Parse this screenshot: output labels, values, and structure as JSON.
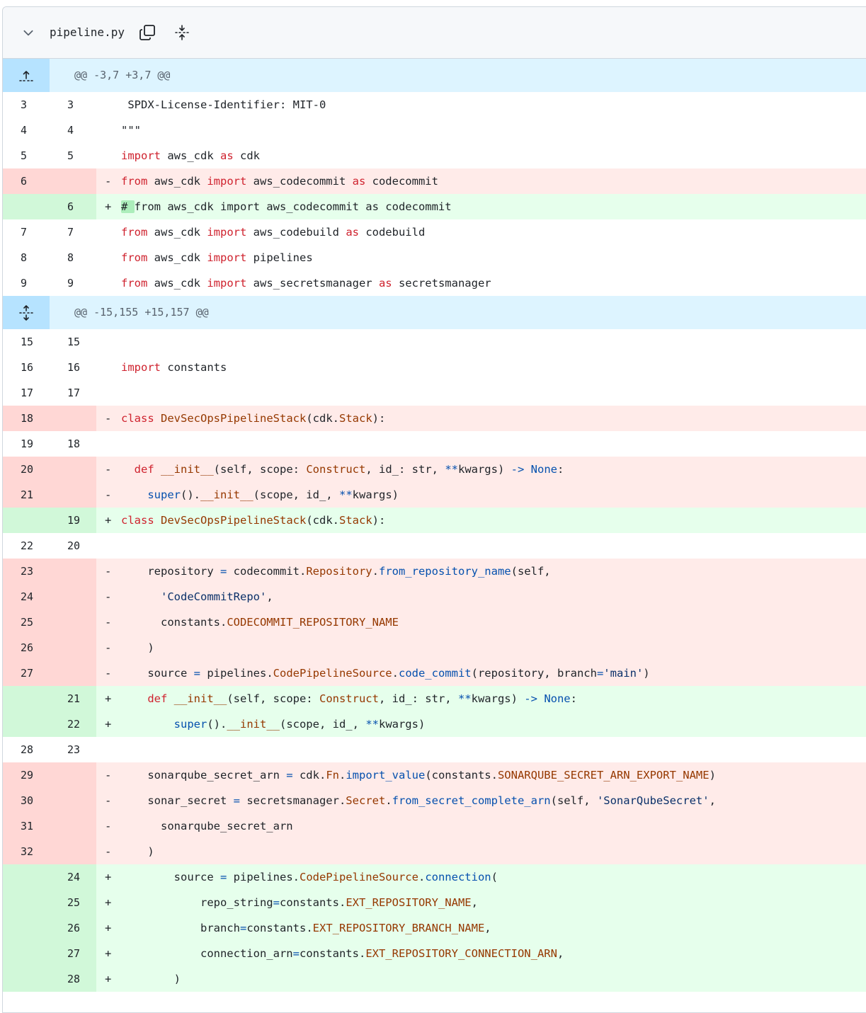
{
  "file": {
    "name": "pipeline.py"
  },
  "hunks": [
    {
      "header": "@@ -3,7 +3,7 @@"
    },
    {
      "header": "@@ -15,155 +15,157 @@"
    }
  ],
  "lines": [
    {
      "type": "ctx",
      "old": "3",
      "new": "3",
      "segs": [
        [
          "p",
          " SPDX-License-Identifier: MIT-0"
        ]
      ]
    },
    {
      "type": "ctx",
      "old": "4",
      "new": "4",
      "segs": [
        [
          "p",
          "\"\"\""
        ]
      ]
    },
    {
      "type": "ctx",
      "old": "5",
      "new": "5",
      "segs": [
        [
          "k",
          "import"
        ],
        [
          "p",
          " aws_cdk "
        ],
        [
          "k",
          "as"
        ],
        [
          "p",
          " cdk"
        ]
      ]
    },
    {
      "type": "del",
      "old": "6",
      "new": "",
      "segs": [
        [
          "k",
          "from"
        ],
        [
          "p",
          " aws_cdk "
        ],
        [
          "k",
          "import"
        ],
        [
          "p",
          " aws_codecommit "
        ],
        [
          "k",
          "as"
        ],
        [
          "p",
          " codecommit"
        ]
      ]
    },
    {
      "type": "add",
      "old": "",
      "new": "6",
      "segs": [
        [
          "hl",
          "# "
        ],
        [
          "p",
          "from aws_cdk import aws_codecommit as codecommit"
        ]
      ]
    },
    {
      "type": "ctx",
      "old": "7",
      "new": "7",
      "segs": [
        [
          "k",
          "from"
        ],
        [
          "p",
          " aws_cdk "
        ],
        [
          "k",
          "import"
        ],
        [
          "p",
          " aws_codebuild "
        ],
        [
          "k",
          "as"
        ],
        [
          "p",
          " codebuild"
        ]
      ]
    },
    {
      "type": "ctx",
      "old": "8",
      "new": "8",
      "segs": [
        [
          "k",
          "from"
        ],
        [
          "p",
          " aws_cdk "
        ],
        [
          "k",
          "import"
        ],
        [
          "p",
          " pipelines"
        ]
      ]
    },
    {
      "type": "ctx",
      "old": "9",
      "new": "9",
      "segs": [
        [
          "k",
          "from"
        ],
        [
          "p",
          " aws_cdk "
        ],
        [
          "k",
          "import"
        ],
        [
          "p",
          " aws_secretsmanager "
        ],
        [
          "k",
          "as"
        ],
        [
          "p",
          " secretsmanager"
        ]
      ]
    },
    {
      "type": "hunk",
      "hunk": 1
    },
    {
      "type": "ctx",
      "old": "15",
      "new": "15",
      "segs": []
    },
    {
      "type": "ctx",
      "old": "16",
      "new": "16",
      "segs": [
        [
          "k",
          "import"
        ],
        [
          "p",
          " constants"
        ]
      ]
    },
    {
      "type": "ctx",
      "old": "17",
      "new": "17",
      "segs": []
    },
    {
      "type": "del",
      "old": "18",
      "new": "",
      "segs": [
        [
          "k",
          "class"
        ],
        [
          "p",
          " "
        ],
        [
          "t",
          "DevSecOpsPipelineStack"
        ],
        [
          "p",
          "(cdk."
        ],
        [
          "t",
          "Stack"
        ],
        [
          "p",
          "):"
        ]
      ]
    },
    {
      "type": "ctx",
      "old": "19",
      "new": "18",
      "segs": []
    },
    {
      "type": "del",
      "old": "20",
      "new": "",
      "segs": [
        [
          "p",
          "  "
        ],
        [
          "k",
          "def"
        ],
        [
          "p",
          " "
        ],
        [
          "t",
          "__init__"
        ],
        [
          "p",
          "(self, scope: "
        ],
        [
          "t",
          "Construct"
        ],
        [
          "p",
          ", id_: str, "
        ],
        [
          "f",
          "**"
        ],
        [
          "p",
          "kwargs) "
        ],
        [
          "f",
          "->"
        ],
        [
          "p",
          " "
        ],
        [
          "f",
          "None"
        ],
        [
          "p",
          ":"
        ]
      ]
    },
    {
      "type": "del",
      "old": "21",
      "new": "",
      "segs": [
        [
          "p",
          "    "
        ],
        [
          "f",
          "super"
        ],
        [
          "p",
          "()."
        ],
        [
          "t",
          "__init__"
        ],
        [
          "p",
          "(scope, id_, "
        ],
        [
          "f",
          "**"
        ],
        [
          "p",
          "kwargs)"
        ]
      ]
    },
    {
      "type": "add",
      "old": "",
      "new": "19",
      "segs": [
        [
          "k",
          "class"
        ],
        [
          "p",
          " "
        ],
        [
          "t",
          "DevSecOpsPipelineStack"
        ],
        [
          "p",
          "(cdk."
        ],
        [
          "t",
          "Stack"
        ],
        [
          "p",
          "):"
        ]
      ]
    },
    {
      "type": "ctx",
      "old": "22",
      "new": "20",
      "segs": []
    },
    {
      "type": "del",
      "old": "23",
      "new": "",
      "segs": [
        [
          "p",
          "    repository "
        ],
        [
          "f",
          "="
        ],
        [
          "p",
          " codecommit."
        ],
        [
          "t",
          "Repository"
        ],
        [
          "p",
          "."
        ],
        [
          "f",
          "from_repository_name"
        ],
        [
          "p",
          "(self,"
        ]
      ]
    },
    {
      "type": "del",
      "old": "24",
      "new": "",
      "segs": [
        [
          "p",
          "      "
        ],
        [
          "s",
          "'CodeCommitRepo'"
        ],
        [
          "p",
          ","
        ]
      ]
    },
    {
      "type": "del",
      "old": "25",
      "new": "",
      "segs": [
        [
          "p",
          "      constants."
        ],
        [
          "t",
          "CODECOMMIT_REPOSITORY_NAME"
        ]
      ]
    },
    {
      "type": "del",
      "old": "26",
      "new": "",
      "segs": [
        [
          "p",
          "    )"
        ]
      ]
    },
    {
      "type": "del",
      "old": "27",
      "new": "",
      "segs": [
        [
          "p",
          "    source "
        ],
        [
          "f",
          "="
        ],
        [
          "p",
          " pipelines."
        ],
        [
          "t",
          "CodePipelineSource"
        ],
        [
          "p",
          "."
        ],
        [
          "f",
          "code_commit"
        ],
        [
          "p",
          "(repository, branch"
        ],
        [
          "f",
          "="
        ],
        [
          "s",
          "'main'"
        ],
        [
          "p",
          ")"
        ]
      ]
    },
    {
      "type": "add",
      "old": "",
      "new": "21",
      "segs": [
        [
          "p",
          "    "
        ],
        [
          "k",
          "def"
        ],
        [
          "p",
          " "
        ],
        [
          "t",
          "__init__"
        ],
        [
          "p",
          "(self, scope: "
        ],
        [
          "t",
          "Construct"
        ],
        [
          "p",
          ", id_: str, "
        ],
        [
          "f",
          "**"
        ],
        [
          "p",
          "kwargs) "
        ],
        [
          "f",
          "->"
        ],
        [
          "p",
          " "
        ],
        [
          "f",
          "None"
        ],
        [
          "p",
          ":"
        ]
      ]
    },
    {
      "type": "add",
      "old": "",
      "new": "22",
      "segs": [
        [
          "p",
          "        "
        ],
        [
          "f",
          "super"
        ],
        [
          "p",
          "()."
        ],
        [
          "t",
          "__init__"
        ],
        [
          "p",
          "(scope, id_, "
        ],
        [
          "f",
          "**"
        ],
        [
          "p",
          "kwargs)"
        ]
      ]
    },
    {
      "type": "ctx",
      "old": "28",
      "new": "23",
      "segs": []
    },
    {
      "type": "del",
      "old": "29",
      "new": "",
      "segs": [
        [
          "p",
          "    sonarqube_secret_arn "
        ],
        [
          "f",
          "="
        ],
        [
          "p",
          " cdk."
        ],
        [
          "t",
          "Fn"
        ],
        [
          "p",
          "."
        ],
        [
          "f",
          "import_value"
        ],
        [
          "p",
          "(constants."
        ],
        [
          "t",
          "SONARQUBE_SECRET_ARN_EXPORT_NAME"
        ],
        [
          "p",
          ")"
        ]
      ]
    },
    {
      "type": "del",
      "old": "30",
      "new": "",
      "segs": [
        [
          "p",
          "    sonar_secret "
        ],
        [
          "f",
          "="
        ],
        [
          "p",
          " secretsmanager."
        ],
        [
          "t",
          "Secret"
        ],
        [
          "p",
          "."
        ],
        [
          "f",
          "from_secret_complete_arn"
        ],
        [
          "p",
          "(self, "
        ],
        [
          "s",
          "'SonarQubeSecret'"
        ],
        [
          "p",
          ","
        ]
      ]
    },
    {
      "type": "del",
      "old": "31",
      "new": "",
      "segs": [
        [
          "p",
          "      sonarqube_secret_arn"
        ]
      ]
    },
    {
      "type": "del",
      "old": "32",
      "new": "",
      "segs": [
        [
          "p",
          "    )"
        ]
      ]
    },
    {
      "type": "add",
      "old": "",
      "new": "24",
      "segs": [
        [
          "p",
          "        source "
        ],
        [
          "f",
          "="
        ],
        [
          "p",
          " pipelines."
        ],
        [
          "t",
          "CodePipelineSource"
        ],
        [
          "p",
          "."
        ],
        [
          "f",
          "connection"
        ],
        [
          "p",
          "("
        ]
      ]
    },
    {
      "type": "add",
      "old": "",
      "new": "25",
      "segs": [
        [
          "p",
          "            repo_string"
        ],
        [
          "f",
          "="
        ],
        [
          "p",
          "constants."
        ],
        [
          "t",
          "EXT_REPOSITORY_NAME"
        ],
        [
          "p",
          ","
        ]
      ]
    },
    {
      "type": "add",
      "old": "",
      "new": "26",
      "segs": [
        [
          "p",
          "            branch"
        ],
        [
          "f",
          "="
        ],
        [
          "p",
          "constants."
        ],
        [
          "t",
          "EXT_REPOSITORY_BRANCH_NAME"
        ],
        [
          "p",
          ","
        ]
      ]
    },
    {
      "type": "add",
      "old": "",
      "new": "27",
      "segs": [
        [
          "p",
          "            connection_arn"
        ],
        [
          "f",
          "="
        ],
        [
          "p",
          "constants."
        ],
        [
          "t",
          "EXT_REPOSITORY_CONNECTION_ARN"
        ],
        [
          "p",
          ","
        ]
      ]
    },
    {
      "type": "add",
      "old": "",
      "new": "28",
      "segs": [
        [
          "p",
          "        )"
        ]
      ]
    }
  ],
  "icons": {
    "collapse": "chevron-down-icon",
    "copy": "copy-icon",
    "expand_all": "unfold-icon",
    "expand_up": "fold-up-icon",
    "expand_both": "unfold-icon"
  },
  "colors": {
    "del_num": "#ffd7d5",
    "del_code": "#ffebe9",
    "add_num": "#d1f8d9",
    "add_code": "#e6ffec",
    "hunk_bg": "#ddf4ff",
    "hunk_exp": "#b6e3ff"
  }
}
